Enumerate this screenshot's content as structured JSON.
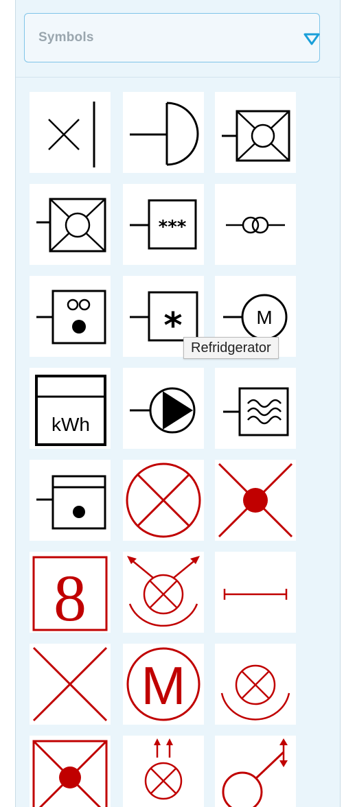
{
  "dropdown": {
    "selected": "Symbols"
  },
  "tooltip": {
    "text": "Refridgerator"
  },
  "colors": {
    "black_symbol": "#000000",
    "red_symbol": "#c00000",
    "accent": "#1a9fd9"
  },
  "symbols": [
    {
      "icon": "switch-x-icon"
    },
    {
      "icon": "half-circle-terminal-icon"
    },
    {
      "icon": "crossed-box-lamp-icon"
    },
    {
      "icon": "crossed-box-lamp-icon"
    },
    {
      "icon": "box-asterisks-icon",
      "label": "***"
    },
    {
      "icon": "transformer-icon"
    },
    {
      "icon": "washing-machine-icon"
    },
    {
      "icon": "refrigerator-icon",
      "label": "*"
    },
    {
      "icon": "motor-icon",
      "label": "M"
    },
    {
      "icon": "kwh-meter-icon",
      "label": "kWh"
    },
    {
      "icon": "pump-icon"
    },
    {
      "icon": "water-heater-icon"
    },
    {
      "icon": "stove-icon"
    },
    {
      "icon": "lamp-red-icon"
    },
    {
      "icon": "lamp-cross-dot-red-icon"
    },
    {
      "icon": "digit-display-red-icon",
      "label": "8"
    },
    {
      "icon": "spot-lamp-arrows-red-icon"
    },
    {
      "icon": "dimension-line-red-icon"
    },
    {
      "icon": "cross-red-icon"
    },
    {
      "icon": "motor-red-icon",
      "label": "M"
    },
    {
      "icon": "lamp-arc-red-icon"
    },
    {
      "icon": "crossed-box-dot-red-icon"
    },
    {
      "icon": "lamp-up-arrows-red-icon"
    },
    {
      "icon": "circle-arrow-red-icon"
    }
  ]
}
